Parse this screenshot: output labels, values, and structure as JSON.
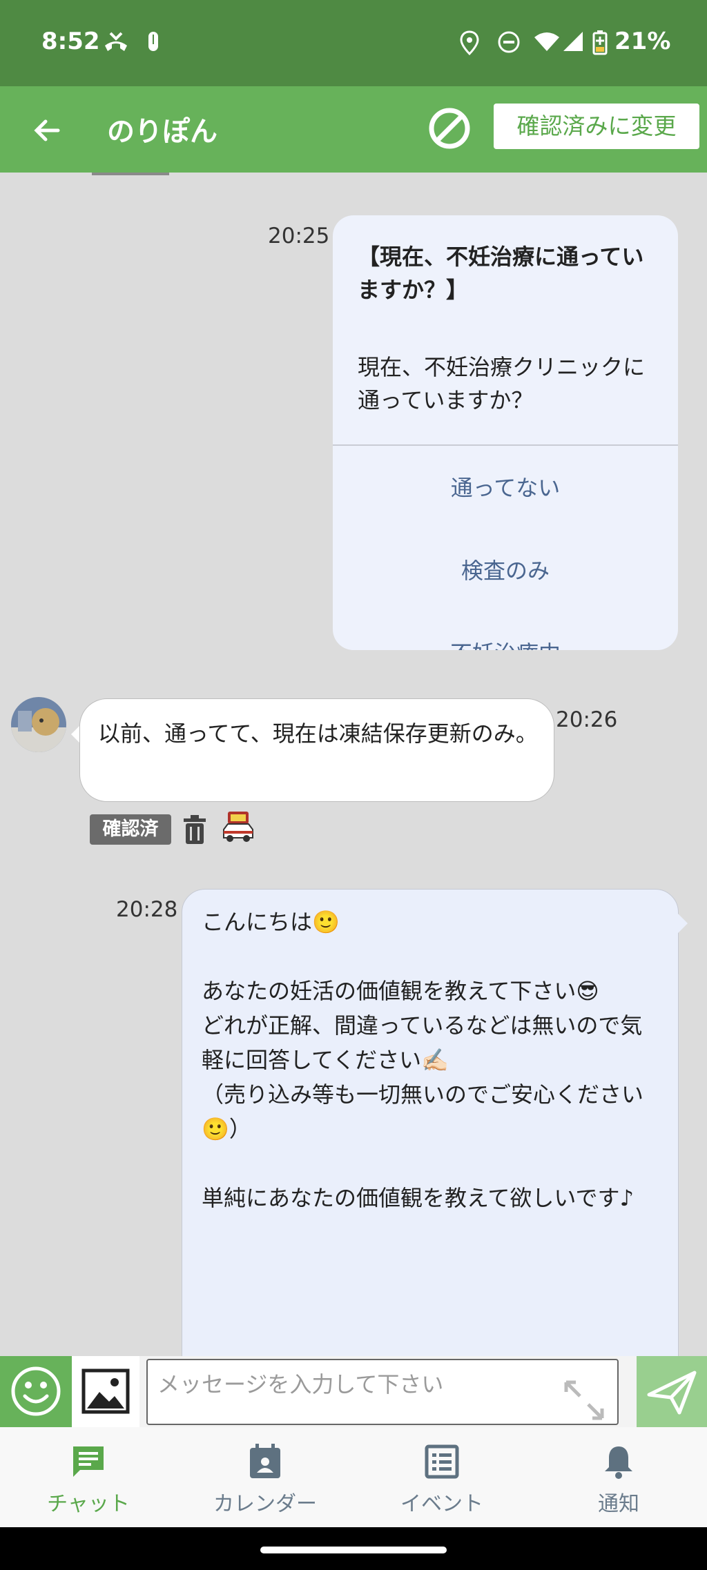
{
  "status_bar": {
    "time": "8:52",
    "battery": "21%"
  },
  "header": {
    "title": "のりぽん",
    "confirm_label": "確認済みに変更"
  },
  "messages": {
    "question": {
      "time": "20:25",
      "title": "【現在、不妊治療に通っていますか？】",
      "body": "現在、不妊治療クリニックに通っていますか？",
      "options": [
        "通ってない",
        "検査のみ",
        "不妊治療中"
      ]
    },
    "received": {
      "time": "20:26",
      "text": "以前、通ってて、現在は凍結保存更新のみ。",
      "badge": "確認済"
    },
    "sent": {
      "time": "20:28",
      "text": "こんにちは🙂\n\nあなたの妊活の価値観を教えて下さい😎\nどれが正解、間違っているなどは無いので気軽に回答してください✍🏻\n（売り込み等も一切無いのでご安心ください🙂）\n\n単純にあなたの価値観を教えて欲しいです♪"
    }
  },
  "input": {
    "placeholder": "メッセージを入力して下さい"
  },
  "nav": {
    "items": [
      {
        "label": "チャット",
        "icon": "chat-icon"
      },
      {
        "label": "カレンダー",
        "icon": "calendar-icon"
      },
      {
        "label": "イベント",
        "icon": "list-icon"
      },
      {
        "label": "通知",
        "icon": "bell-icon"
      }
    ]
  },
  "colors": {
    "header": "#67b25a",
    "status": "#4f8a43",
    "accent": "#5aa84b"
  }
}
